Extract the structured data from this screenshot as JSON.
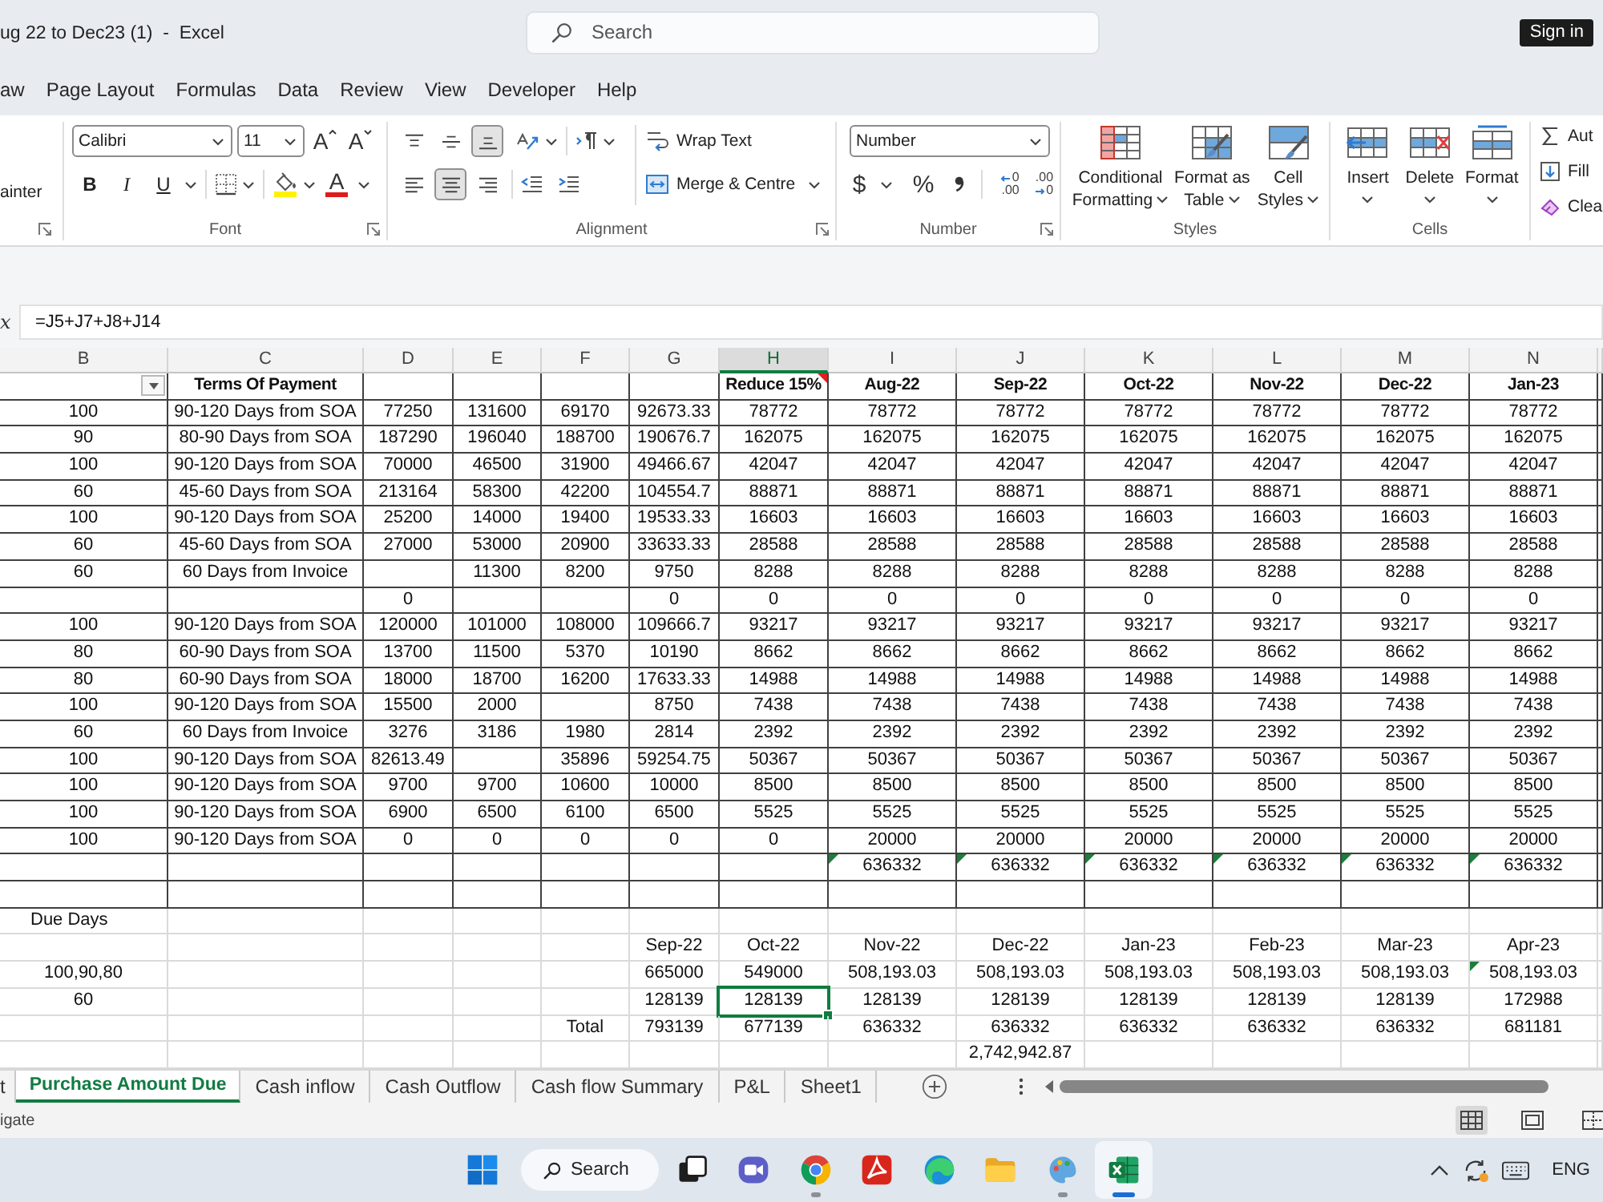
{
  "window": {
    "title": "ug 22 to Dec23 (1)  -  Excel",
    "search": {
      "placeholder": "Search"
    },
    "sign_in": "Sign in"
  },
  "menu": [
    "aw",
    "Page Layout",
    "Formulas",
    "Data",
    "Review",
    "View",
    "Developer",
    "Help"
  ],
  "ribbon": {
    "clipboard": {
      "format_painter": "ainter"
    },
    "font": {
      "label": "Font",
      "name": "Calibri",
      "size": "11",
      "grow": "A",
      "shrink": "A",
      "bold": "B",
      "italic": "I",
      "underline": "U",
      "font_color": "A"
    },
    "alignment": {
      "label": "Alignment",
      "vertical": [
        {
          "kind": "top",
          "selected": false
        },
        {
          "kind": "middle",
          "selected": false
        },
        {
          "kind": "bottom",
          "selected": true
        }
      ],
      "horizontal": [
        {
          "kind": "left",
          "selected": false
        },
        {
          "kind": "center",
          "selected": true
        },
        {
          "kind": "right",
          "selected": false
        }
      ],
      "wrap_text": "Wrap Text",
      "merge": "Merge & Centre"
    },
    "number": {
      "label": "Number",
      "format": "Number",
      "currency": "$",
      "percent": "%",
      "increase_decimal": [
        "0",
        ".00"
      ],
      "decrease_decimal": [
        ".00",
        "0"
      ]
    },
    "styles": {
      "label": "Styles",
      "buttons": [
        {
          "kind": "conditional",
          "label": "Conditional Formatting"
        },
        {
          "kind": "table",
          "label": "Format as Table"
        },
        {
          "kind": "cell",
          "label": "Cell Styles"
        }
      ]
    },
    "cells": {
      "label": "Cells",
      "buttons": [
        {
          "kind": "insert",
          "label": "Insert"
        },
        {
          "kind": "delete",
          "label": "Delete"
        },
        {
          "kind": "format",
          "label": "Format"
        }
      ]
    },
    "editing": {
      "autosum": "Aut",
      "fill": "Fill",
      "clear": "Clea"
    }
  },
  "formula_bar": {
    "function_label": "x",
    "formula": "=J5+J7+J8+J14"
  },
  "sheet": {
    "columns": [
      {
        "label": "B",
        "selected": false
      },
      {
        "label": "C",
        "selected": false
      },
      {
        "label": "D",
        "selected": false
      },
      {
        "label": "E",
        "selected": false
      },
      {
        "label": "F",
        "selected": false
      },
      {
        "label": "G",
        "selected": false
      },
      {
        "label": "H",
        "selected": true
      },
      {
        "label": "I",
        "selected": false
      },
      {
        "label": "J",
        "selected": false
      },
      {
        "label": "K",
        "selected": false
      },
      {
        "label": "L",
        "selected": false
      },
      {
        "label": "M",
        "selected": false
      },
      {
        "label": "N",
        "selected": false
      }
    ],
    "rows": [
      {
        "kind": "header",
        "selected": false,
        "cells": [
          {
            "filter": true
          },
          "Terms Of Payment",
          null,
          null,
          null,
          null,
          {
            "text": "Reduce 15%",
            "comment": true
          },
          "Aug-22",
          "Sep-22",
          "Oct-22",
          "Nov-22",
          "Dec-22",
          "Jan-23"
        ]
      },
      {
        "kind": "bordered",
        "selected": false,
        "cells": [
          "100",
          "90-120 Days from SOA",
          "77250",
          "131600",
          "69170",
          "92673.33",
          "78772",
          "78772",
          "78772",
          "78772",
          "78772",
          "78772",
          "78772"
        ]
      },
      {
        "kind": "bordered",
        "selected": false,
        "cells": [
          "90",
          "80-90 Days from SOA",
          "187290",
          "196040",
          "188700",
          "190676.7",
          "162075",
          "162075",
          "162075",
          "162075",
          "162075",
          "162075",
          "162075"
        ]
      },
      {
        "kind": "bordered",
        "selected": false,
        "cells": [
          "100",
          "90-120 Days from SOA",
          "70000",
          "46500",
          "31900",
          "49466.67",
          "42047",
          "42047",
          "42047",
          "42047",
          "42047",
          "42047",
          "42047"
        ]
      },
      {
        "kind": "bordered",
        "selected": false,
        "cells": [
          "60",
          "45-60 Days from SOA",
          "213164",
          "58300",
          "42200",
          "104554.7",
          "88871",
          "88871",
          "88871",
          "88871",
          "88871",
          "88871",
          "88871"
        ]
      },
      {
        "kind": "bordered",
        "selected": false,
        "cells": [
          "100",
          "90-120 Days from SOA",
          "25200",
          "14000",
          "19400",
          "19533.33",
          "16603",
          "16603",
          "16603",
          "16603",
          "16603",
          "16603",
          "16603"
        ]
      },
      {
        "kind": "bordered",
        "selected": false,
        "cells": [
          "60",
          "45-60 Days from SOA",
          "27000",
          "53000",
          "20900",
          "33633.33",
          "28588",
          "28588",
          "28588",
          "28588",
          "28588",
          "28588",
          "28588"
        ]
      },
      {
        "kind": "bordered",
        "selected": false,
        "cells": [
          "60",
          "60 Days from Invoice",
          null,
          "11300",
          "8200",
          "9750",
          "8288",
          "8288",
          "8288",
          "8288",
          "8288",
          "8288",
          "8288"
        ]
      },
      {
        "kind": "bordered",
        "selected": false,
        "cells": [
          null,
          null,
          "0",
          null,
          null,
          "0",
          "0",
          "0",
          "0",
          "0",
          "0",
          "0",
          "0"
        ]
      },
      {
        "kind": "bordered",
        "selected": false,
        "cells": [
          "100",
          "90-120 Days from SOA",
          "120000",
          "101000",
          "108000",
          "109666.7",
          "93217",
          "93217",
          "93217",
          "93217",
          "93217",
          "93217",
          "93217"
        ]
      },
      {
        "kind": "bordered",
        "selected": false,
        "cells": [
          "80",
          "60-90 Days from SOA",
          "13700",
          "11500",
          "5370",
          "10190",
          "8662",
          "8662",
          "8662",
          "8662",
          "8662",
          "8662",
          "8662"
        ]
      },
      {
        "kind": "bordered",
        "selected": false,
        "cells": [
          "80",
          "60-90 Days from SOA",
          "18000",
          "18700",
          "16200",
          "17633.33",
          "14988",
          "14988",
          "14988",
          "14988",
          "14988",
          "14988",
          "14988"
        ]
      },
      {
        "kind": "bordered",
        "selected": false,
        "cells": [
          "100",
          "90-120 Days from SOA",
          "15500",
          "2000",
          null,
          "8750",
          "7438",
          "7438",
          "7438",
          "7438",
          "7438",
          "7438",
          "7438"
        ]
      },
      {
        "kind": "bordered",
        "selected": false,
        "cells": [
          "60",
          "60 Days from Invoice",
          "3276",
          "3186",
          "1980",
          "2814",
          "2392",
          "2392",
          "2392",
          "2392",
          "2392",
          "2392",
          "2392"
        ]
      },
      {
        "kind": "bordered",
        "selected": false,
        "cells": [
          "100",
          "90-120 Days from SOA",
          "82613.49",
          null,
          "35896",
          "59254.75",
          "50367",
          "50367",
          "50367",
          "50367",
          "50367",
          "50367",
          "50367"
        ]
      },
      {
        "kind": "bordered",
        "selected": false,
        "cells": [
          "100",
          "90-120 Days from SOA",
          "9700",
          "9700",
          "10600",
          "10000",
          "8500",
          "8500",
          "8500",
          "8500",
          "8500",
          "8500",
          "8500"
        ]
      },
      {
        "kind": "bordered",
        "selected": false,
        "cells": [
          "100",
          "90-120 Days from SOA",
          "6900",
          "6500",
          "6100",
          "6500",
          "5525",
          "5525",
          "5525",
          "5525",
          "5525",
          "5525",
          "5525"
        ]
      },
      {
        "kind": "bordered",
        "selected": false,
        "cells": [
          "100",
          "90-120 Days from SOA",
          "0",
          "0",
          "0",
          "0",
          "0",
          "20000",
          "20000",
          "20000",
          "20000",
          "20000",
          "20000"
        ]
      },
      {
        "kind": "bordered",
        "selected": false,
        "cells": [
          null,
          null,
          null,
          null,
          null,
          null,
          null,
          {
            "text": "636332",
            "error": true
          },
          {
            "text": "636332",
            "error": true
          },
          {
            "text": "636332",
            "error": true
          },
          {
            "text": "636332",
            "error": true
          },
          {
            "text": "636332",
            "error": true
          },
          {
            "text": "636332",
            "error": true
          }
        ]
      },
      {
        "kind": "bordered",
        "selected": false,
        "cells": [
          null,
          null,
          null,
          null,
          null,
          null,
          null,
          null,
          null,
          null,
          null,
          null,
          null
        ]
      },
      {
        "kind": "caption",
        "selected": false,
        "cells": [
          "Due Days",
          null,
          null,
          null,
          null,
          null,
          null,
          null,
          null,
          null,
          null,
          null,
          null
        ]
      },
      {
        "kind": "plain",
        "selected": false,
        "cells": [
          null,
          null,
          null,
          null,
          null,
          "Sep-22",
          "Oct-22",
          "Nov-22",
          "Dec-22",
          "Jan-23",
          "Feb-23",
          "Mar-23",
          "Apr-23"
        ]
      },
      {
        "kind": "plain",
        "selected": false,
        "cells": [
          "100,90,80",
          null,
          null,
          null,
          null,
          "665000",
          "549000",
          "508,193.03",
          "508,193.03",
          "508,193.03",
          "508,193.03",
          "508,193.03",
          {
            "text": "508,193.03",
            "error": true
          }
        ]
      },
      {
        "kind": "plain",
        "selected": true,
        "cells": [
          "60",
          null,
          null,
          null,
          null,
          "128139",
          "128139",
          "128139",
          "128139",
          "128139",
          "128139",
          "128139",
          "172988"
        ]
      },
      {
        "kind": "plain",
        "selected": false,
        "cells": [
          null,
          null,
          null,
          null,
          "Total",
          "793139",
          "677139",
          "636332",
          "636332",
          "636332",
          "636332",
          "636332",
          "681181"
        ]
      },
      {
        "kind": "plain",
        "selected": false,
        "cells": [
          null,
          null,
          null,
          null,
          null,
          null,
          null,
          null,
          "2,742,942.87",
          null,
          null,
          null,
          null
        ]
      }
    ]
  },
  "sheet_tabs": [
    {
      "label": "t",
      "selected": false
    },
    {
      "label": "Purchase Amount Due",
      "selected": true
    },
    {
      "label": "Cash inflow",
      "selected": false
    },
    {
      "label": "Cash Outflow",
      "selected": false
    },
    {
      "label": "Cash flow Summary",
      "selected": false
    },
    {
      "label": "P&L",
      "selected": false
    },
    {
      "label": "Sheet1",
      "selected": false
    }
  ],
  "status_bar": {
    "text": "igate",
    "views": [
      {
        "kind": "normal",
        "selected": true
      },
      {
        "kind": "layout",
        "selected": false
      },
      {
        "kind": "pagebreak",
        "selected": false
      }
    ]
  },
  "taskbar": {
    "search": "Search",
    "apps": [
      {
        "kind": "taskview",
        "running": false,
        "selected": false
      },
      {
        "kind": "chat",
        "running": false,
        "selected": false
      },
      {
        "kind": "wheel",
        "running": true,
        "selected": false
      },
      {
        "kind": "pdf",
        "running": false,
        "selected": false
      },
      {
        "kind": "wave",
        "running": false,
        "selected": false
      },
      {
        "kind": "folder",
        "running": false,
        "selected": false
      },
      {
        "kind": "palette",
        "running": true,
        "selected": false
      },
      {
        "kind": "sheet",
        "running": true,
        "selected": true
      }
    ],
    "language": "ENG"
  }
}
